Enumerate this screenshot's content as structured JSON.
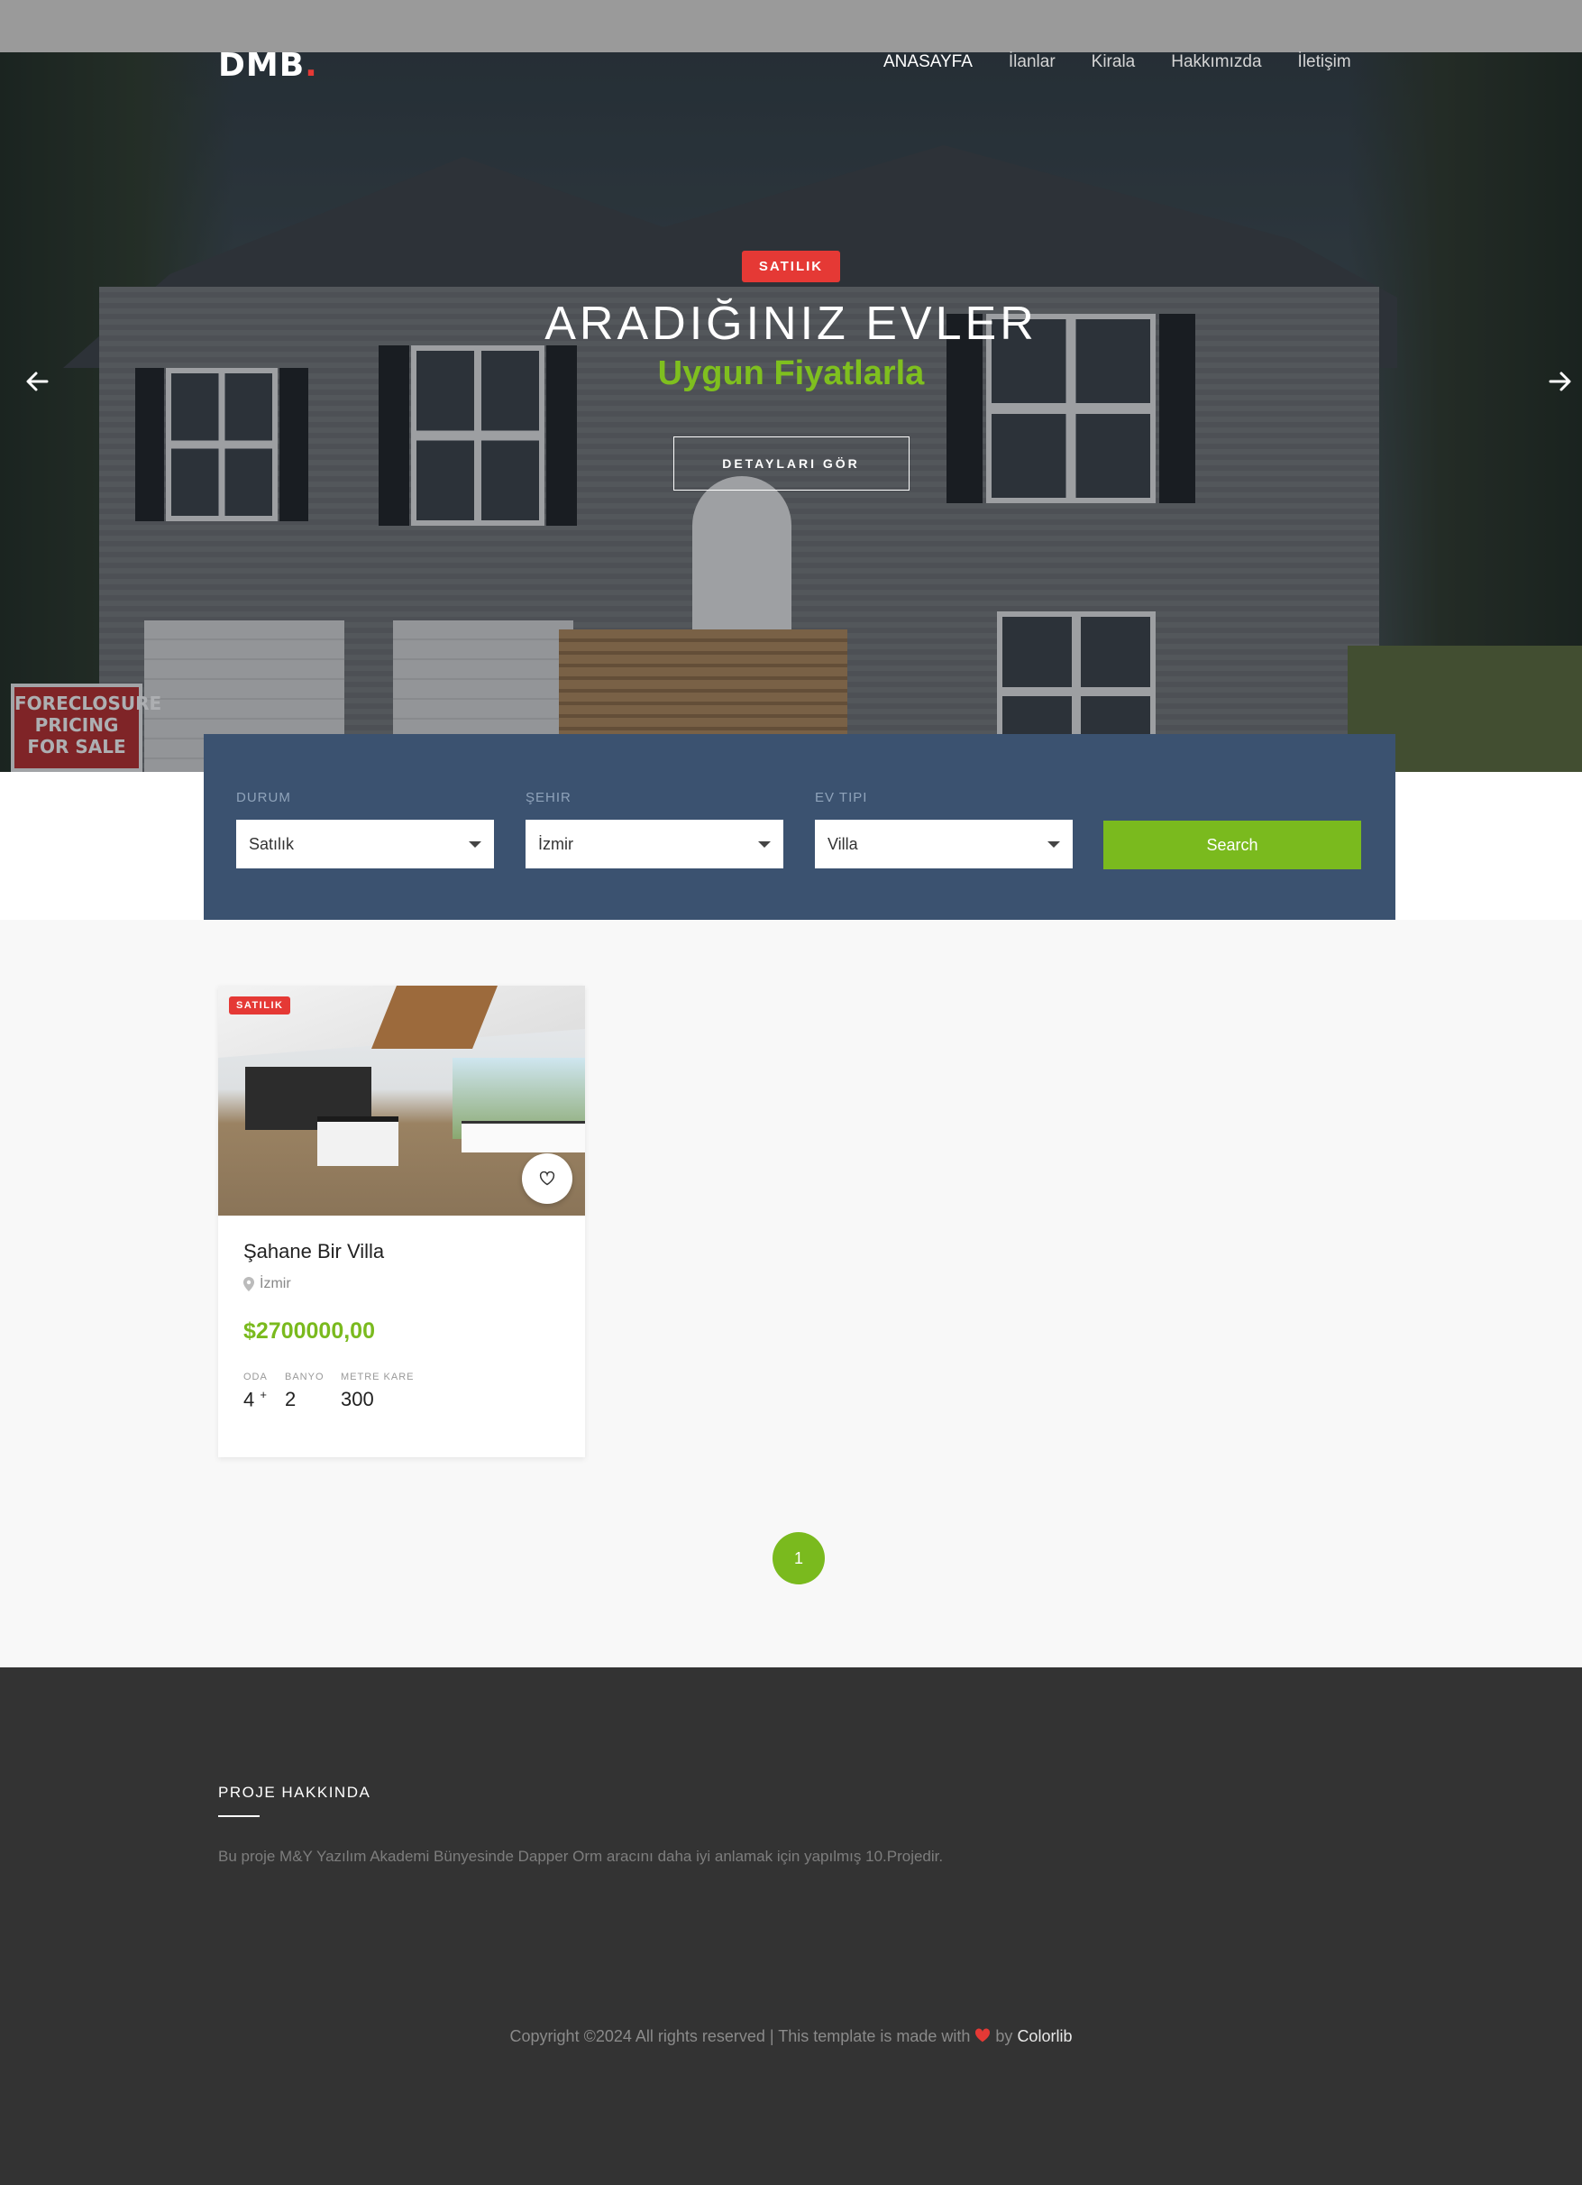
{
  "brand": {
    "logo_text": "DMB",
    "logo_dot": "."
  },
  "nav": {
    "items": [
      {
        "label": "ANASAYFA",
        "active": true
      },
      {
        "label": "İlanlar",
        "active": false
      },
      {
        "label": "Kirala",
        "active": false
      },
      {
        "label": "Hakkımızda",
        "active": false
      },
      {
        "label": "İletişim",
        "active": false
      }
    ]
  },
  "hero": {
    "badge": "SATILIK",
    "title": "ARADIĞINIZ EVLER",
    "subtitle": "Uygun Fiyatlarla",
    "button": "DETAYLARI GÖR",
    "sign_text": "FORECLOSURE PRICING FOR SALE"
  },
  "search": {
    "status_label": "DURUM",
    "status_value": "Satılık",
    "city_label": "ŞEHIR",
    "city_value": "İzmir",
    "type_label": "EV TIPI",
    "type_value": "Villa",
    "button": "Search"
  },
  "listing": {
    "badge": "SATILIK",
    "title": "Şahane Bir Villa",
    "location": "İzmir",
    "price": "$2700000,00",
    "rooms_label": "ODA",
    "rooms_value": "4",
    "rooms_plus": "+",
    "bath_label": "BANYO",
    "bath_value": "2",
    "area_label": "METRE KARE",
    "area_value": "300"
  },
  "pagination": {
    "current": "1"
  },
  "footer": {
    "heading": "PROJE HAKKINDA",
    "text": "Bu proje M&Y Yazılım Akademi Bünyesinde Dapper Orm aracını daha iyi anlamak için yapılmış 10.Projedir.",
    "copyright_prefix": "Copyright ©2024 All rights reserved | This template is made with",
    "by": "by",
    "link": "Colorlib"
  },
  "colors": {
    "accent_green": "#7aba1e",
    "accent_red": "#e53935",
    "search_bg": "#3b5270",
    "footer_bg": "#333333"
  },
  "icons": {
    "prev": "arrow-left-icon",
    "next": "arrow-right-icon",
    "favorite": "heart-outline-icon",
    "location": "map-pin-icon",
    "love": "heart-icon"
  }
}
